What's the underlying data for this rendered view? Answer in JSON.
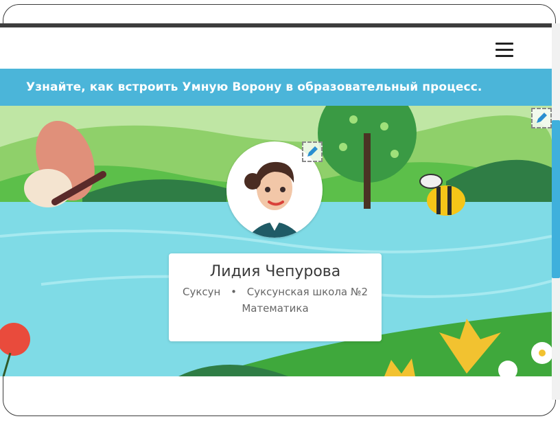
{
  "banner": {
    "text": "Узнайте, как встроить Умную Ворону в образовательный процесс."
  },
  "header": {
    "menu_icon": "hamburger-menu-icon"
  },
  "profile": {
    "name": "Лидия Чепурова",
    "city": "Суксун",
    "separator": "•",
    "school": "Суксунская школа №2",
    "subject": "Математика"
  },
  "icons": {
    "edit_cover": "pencil-icon",
    "edit_avatar": "pencil-icon"
  },
  "colors": {
    "banner": "#4bb5d9",
    "scroll_accent": "#3fb0dc",
    "water": "#7fdbe6",
    "grass": "#5fbf4a"
  }
}
